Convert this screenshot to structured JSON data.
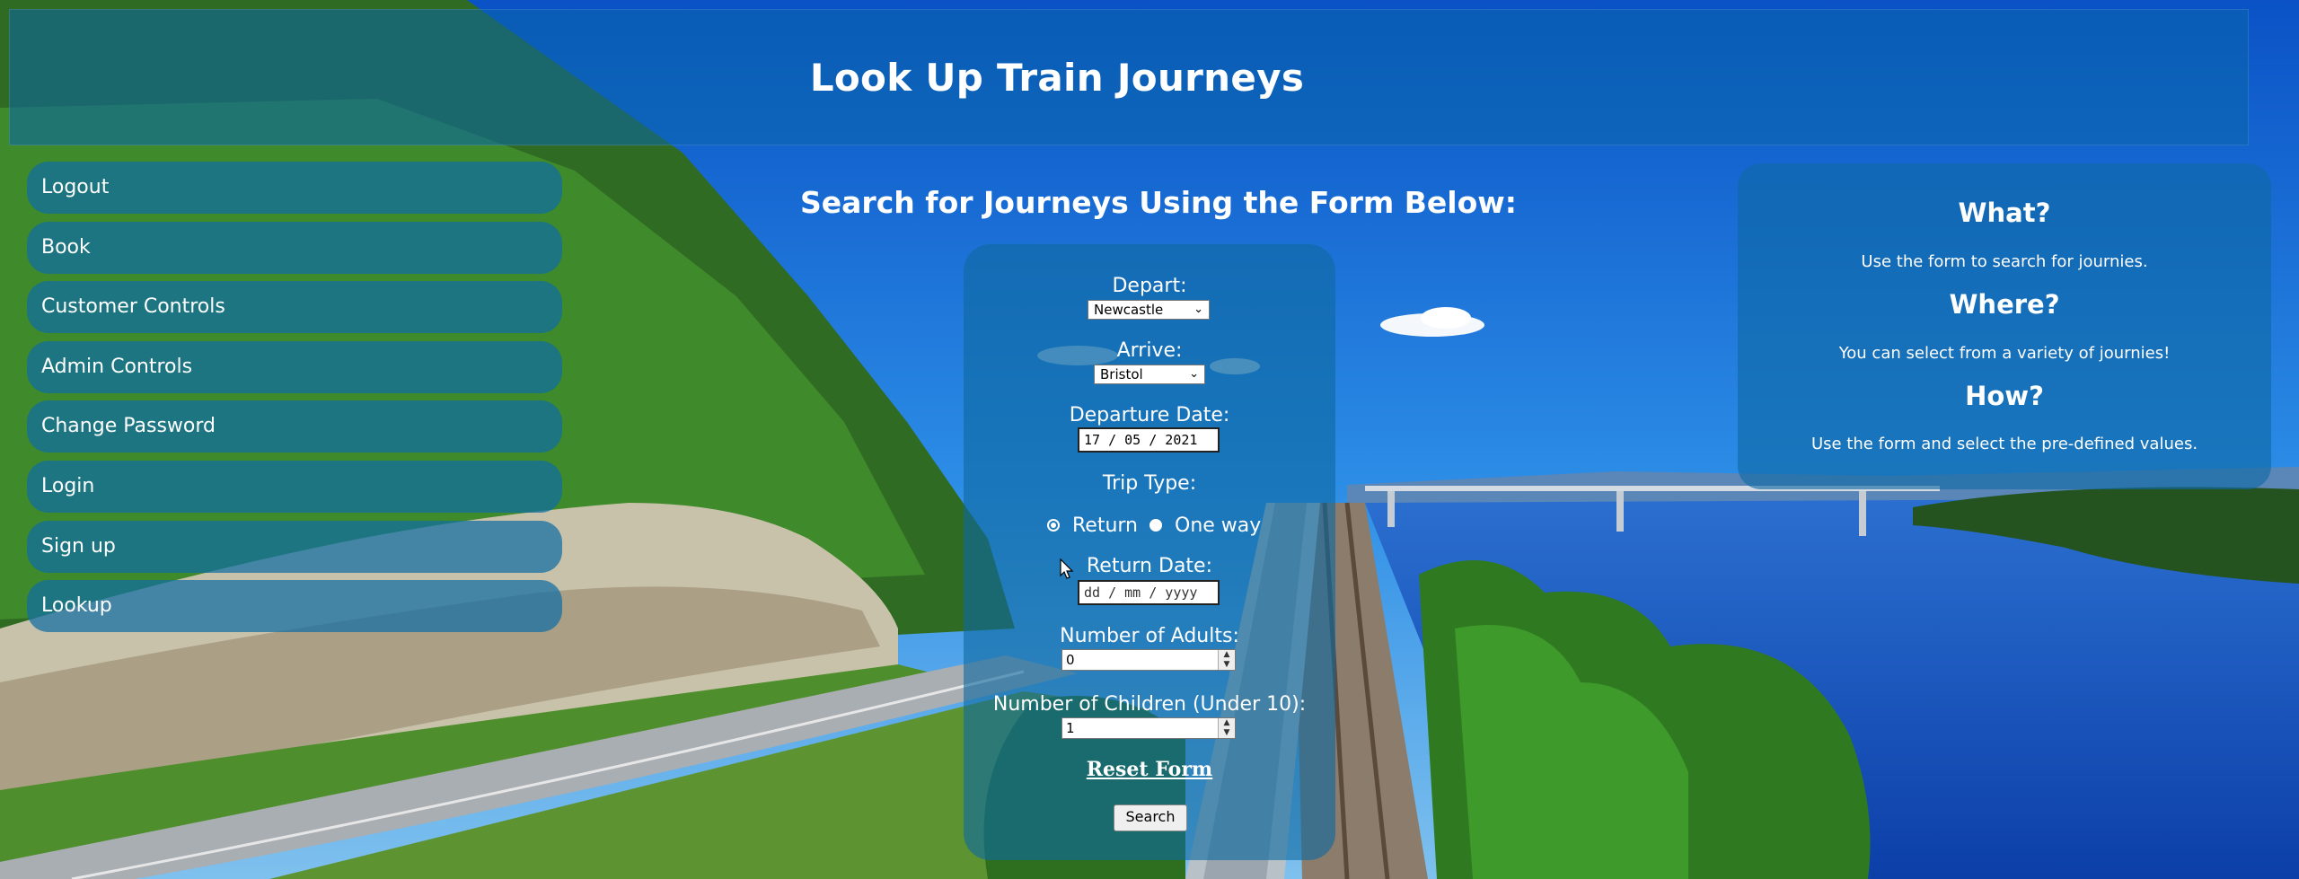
{
  "page": {
    "title": "Look Up Train Journeys"
  },
  "nav": {
    "items": [
      {
        "label": "Logout"
      },
      {
        "label": "Book"
      },
      {
        "label": "Customer Controls"
      },
      {
        "label": "Admin Controls"
      },
      {
        "label": "Change Password"
      },
      {
        "label": "Login"
      },
      {
        "label": "Sign up"
      },
      {
        "label": "Lookup"
      }
    ]
  },
  "search": {
    "heading": "Search for Journeys Using the Form Below:",
    "depart_label": "Depart:",
    "depart_value": "Newcastle",
    "arrive_label": "Arrive:",
    "arrive_value": "Bristol",
    "departure_date_label": "Departure Date:",
    "departure_date_value": "17 / 05 / 2021",
    "trip_type_label": "Trip Type:",
    "trip_options": [
      {
        "label": "Return",
        "selected": true
      },
      {
        "label": "One way",
        "selected": false
      }
    ],
    "return_date_label": "Return Date:",
    "return_date_placeholder": "dd / mm / yyyy",
    "adults_label": "Number of Adults:",
    "adults_value": "0",
    "children_label": "Number of Children (Under 10):",
    "children_value": "1",
    "reset_label": "Reset Form",
    "search_button": "Search"
  },
  "info": {
    "what_heading": "What?",
    "what_text": "Use the form to search for journies.",
    "where_heading": "Where?",
    "where_text": "You can select from a variety of journies!",
    "how_heading": "How?",
    "how_text": "Use the form and select the pre-defined values."
  },
  "colors": {
    "panel": "#0a64aa",
    "text": "#ffffff"
  }
}
